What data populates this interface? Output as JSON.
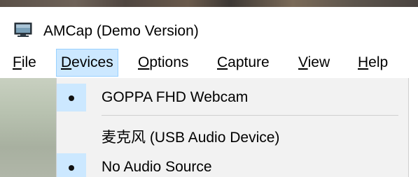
{
  "window": {
    "title": "AMCap (Demo Version)",
    "icon": "amcap-app-icon"
  },
  "menubar": {
    "items": [
      {
        "label": "File",
        "accelerator": "F",
        "rest": "ile"
      },
      {
        "label": "Devices",
        "accelerator": "D",
        "rest": "evices"
      },
      {
        "label": "Options",
        "accelerator": "O",
        "rest": "ptions"
      },
      {
        "label": "Capture",
        "accelerator": "C",
        "rest": "apture"
      },
      {
        "label": "View",
        "accelerator": "V",
        "rest": "iew"
      },
      {
        "label": "Help",
        "accelerator": "H",
        "rest": "elp"
      }
    ],
    "active": "Devices"
  },
  "devices_menu": {
    "items": [
      {
        "label": "GOPPA FHD Webcam",
        "checked": true
      },
      {
        "label": "麦克风 (USB Audio Device)",
        "checked": false
      },
      {
        "label": "No Audio Source",
        "checked": true
      }
    ]
  },
  "colors": {
    "menu_highlight": "#cce8ff",
    "menu_highlight_border": "#99d1ff",
    "dropdown_bg": "#f2f2f2"
  }
}
